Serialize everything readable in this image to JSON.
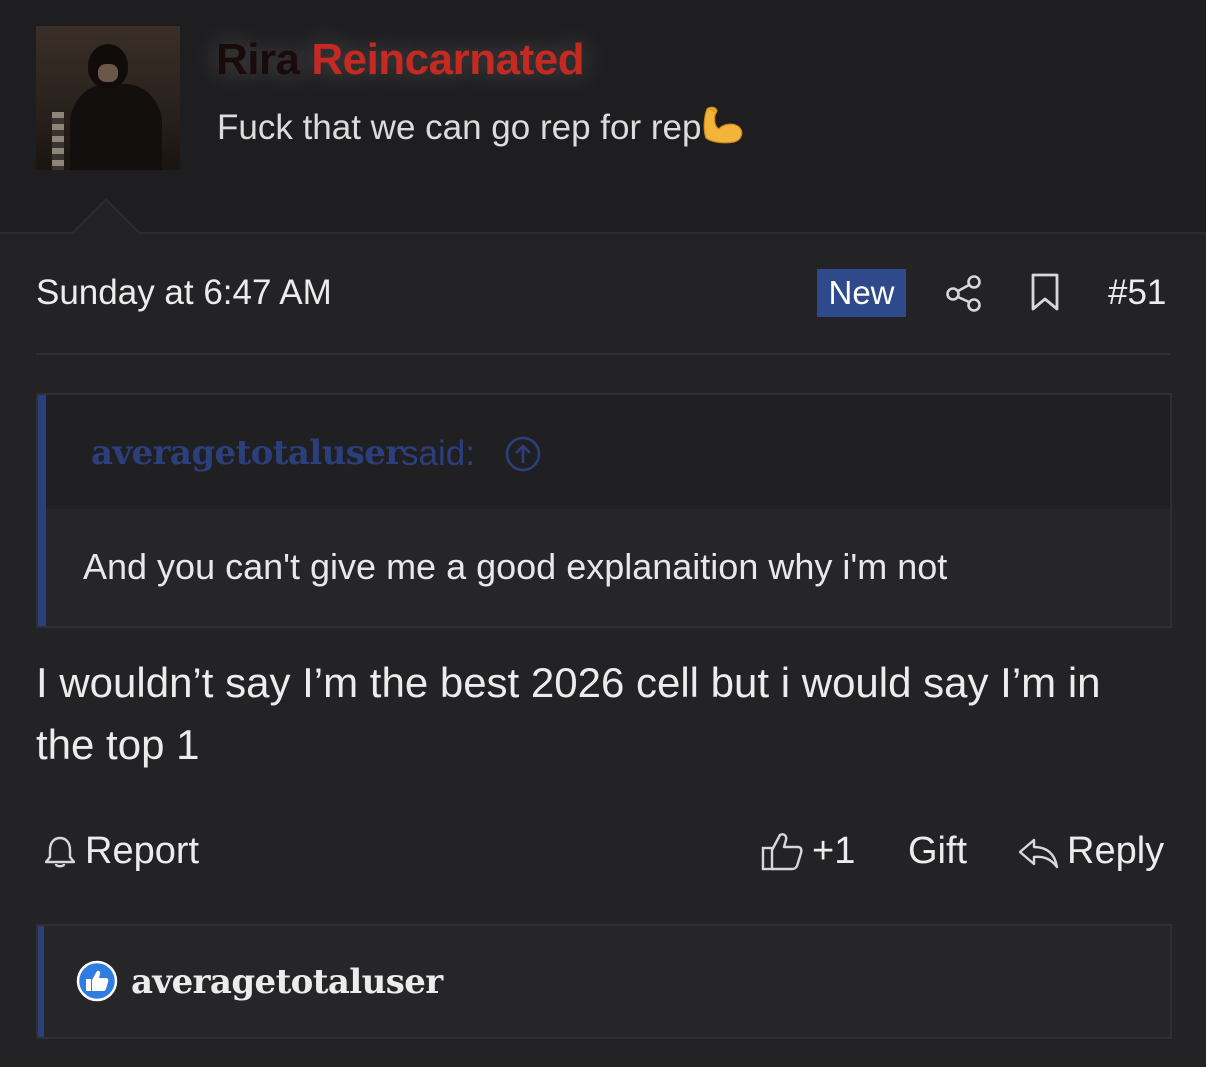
{
  "user": {
    "name_first": "Rira",
    "name_second": "Reincarnated",
    "title": "Fuck that we can go rep for rep",
    "title_emoji": "flexed-biceps-icon"
  },
  "post": {
    "timestamp": "Sunday at 6:47 AM",
    "new_badge": "New",
    "number": "#51",
    "body": "I wouldn’t say I’m the best 2026 cell but i would say I’m in the top 1"
  },
  "quote": {
    "author": "averagetotaluser",
    "said": "said:",
    "text": "And you can't give me a good explanaition why i'm not"
  },
  "actions": {
    "report": "Report",
    "like_count": "+1",
    "gift": "Gift",
    "reply": "Reply"
  },
  "reactions": {
    "users": [
      "averagetotaluser"
    ]
  },
  "colors": {
    "background": "#232325",
    "accent_blue": "#2c3f7d",
    "badge_blue": "#2e4a8a",
    "name_red": "#c52a22"
  }
}
